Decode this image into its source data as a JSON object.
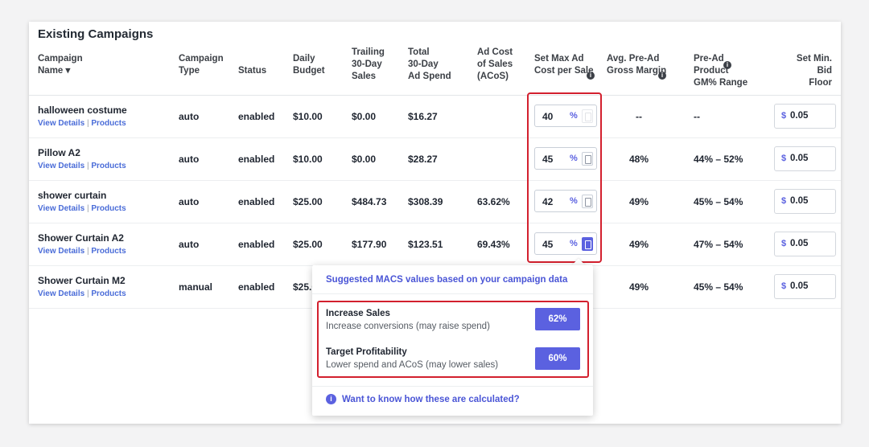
{
  "section_title": "Existing Campaigns",
  "headers": {
    "campaign_name": [
      "Campaign",
      "Name ▾"
    ],
    "campaign_type": [
      "Campaign",
      "Type"
    ],
    "status": [
      "Status"
    ],
    "daily_budget": [
      "Daily",
      "Budget"
    ],
    "trailing_sales": [
      "Trailing",
      "30-Day",
      "Sales"
    ],
    "total_spend": [
      "Total",
      "30-Day",
      "Ad Spend"
    ],
    "acos": [
      "Ad Cost",
      "of Sales",
      "(ACoS)"
    ],
    "set_macs": [
      "Set Max Ad",
      "Cost per Sale"
    ],
    "avg_margin": [
      "Avg. Pre-Ad",
      "Gross Margin"
    ],
    "gm_range": [
      "Pre-Ad",
      "Product",
      "GM% Range"
    ],
    "bid_floor": [
      "Set Min.",
      "Bid Floor"
    ]
  },
  "link_labels": {
    "details": "View Details",
    "separator": "|",
    "products": "Products"
  },
  "percent_symbol": "%",
  "currency_symbol": "$",
  "rows": [
    {
      "name": "halloween costume",
      "type": "auto",
      "status": "enabled",
      "budget": "$10.00",
      "sales": "$0.00",
      "spend": "$16.27",
      "acos": "",
      "macs": "40",
      "margin": "--",
      "range": "--",
      "bid": "0.05"
    },
    {
      "name": "Pillow A2",
      "type": "auto",
      "status": "enabled",
      "budget": "$10.00",
      "sales": "$0.00",
      "spend": "$28.27",
      "acos": "",
      "macs": "45",
      "margin": "48%",
      "range": "44% – 52%",
      "bid": "0.05"
    },
    {
      "name": "shower curtain",
      "type": "auto",
      "status": "enabled",
      "budget": "$25.00",
      "sales": "$484.73",
      "spend": "$308.39",
      "acos": "63.62%",
      "macs": "42",
      "margin": "49%",
      "range": "45% – 54%",
      "bid": "0.05"
    },
    {
      "name": "Shower Curtain A2",
      "type": "auto",
      "status": "enabled",
      "budget": "$25.00",
      "sales": "$177.90",
      "spend": "$123.51",
      "acos": "69.43%",
      "macs": "45",
      "margin": "49%",
      "range": "47% – 54%",
      "bid": "0.05"
    },
    {
      "name": "Shower Curtain M2",
      "type": "manual",
      "status": "enabled",
      "budget": "$25.0",
      "sales": "",
      "spend": "",
      "acos": "",
      "macs": "",
      "margin": "49%",
      "range": "45% – 54%",
      "bid": "0.05"
    }
  ],
  "popover": {
    "heading": "Suggested MACS values based on your campaign data",
    "options": [
      {
        "title": "Increase Sales",
        "description": "Increase conversions (may raise spend)",
        "value": "62%"
      },
      {
        "title": "Target Profitability",
        "description": "Lower spend and ACoS (may lower sales)",
        "value": "60%"
      }
    ],
    "footer_link": "Want to know how these are calculated?"
  },
  "colors": {
    "accent": "#5b61e0",
    "highlight": "#d3202e",
    "link": "#4a6cd8"
  }
}
